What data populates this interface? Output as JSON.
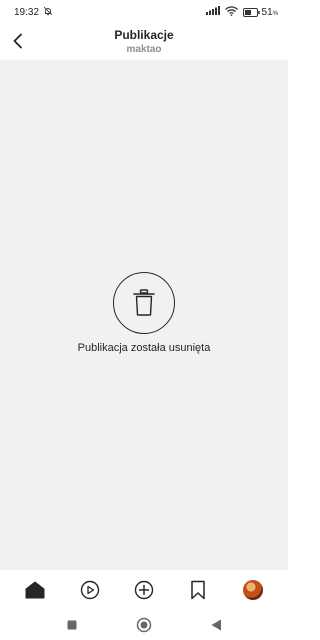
{
  "status_bar": {
    "time": "19:32",
    "battery": "51",
    "battery_unit": "%"
  },
  "header": {
    "title": "Publikacje",
    "subtitle": "maktao"
  },
  "main": {
    "deleted_message": "Publikacja została usunięta"
  },
  "icons": {
    "back": "chevron-left-icon",
    "trash": "trash-icon",
    "home": "home-icon",
    "reels": "play-circle-icon",
    "create": "plus-circle-icon",
    "saved": "bookmark-icon",
    "profile": "avatar"
  },
  "colors": {
    "background": "#f1f1f1",
    "text": "#262626",
    "subtitle": "#8e8e8e"
  }
}
